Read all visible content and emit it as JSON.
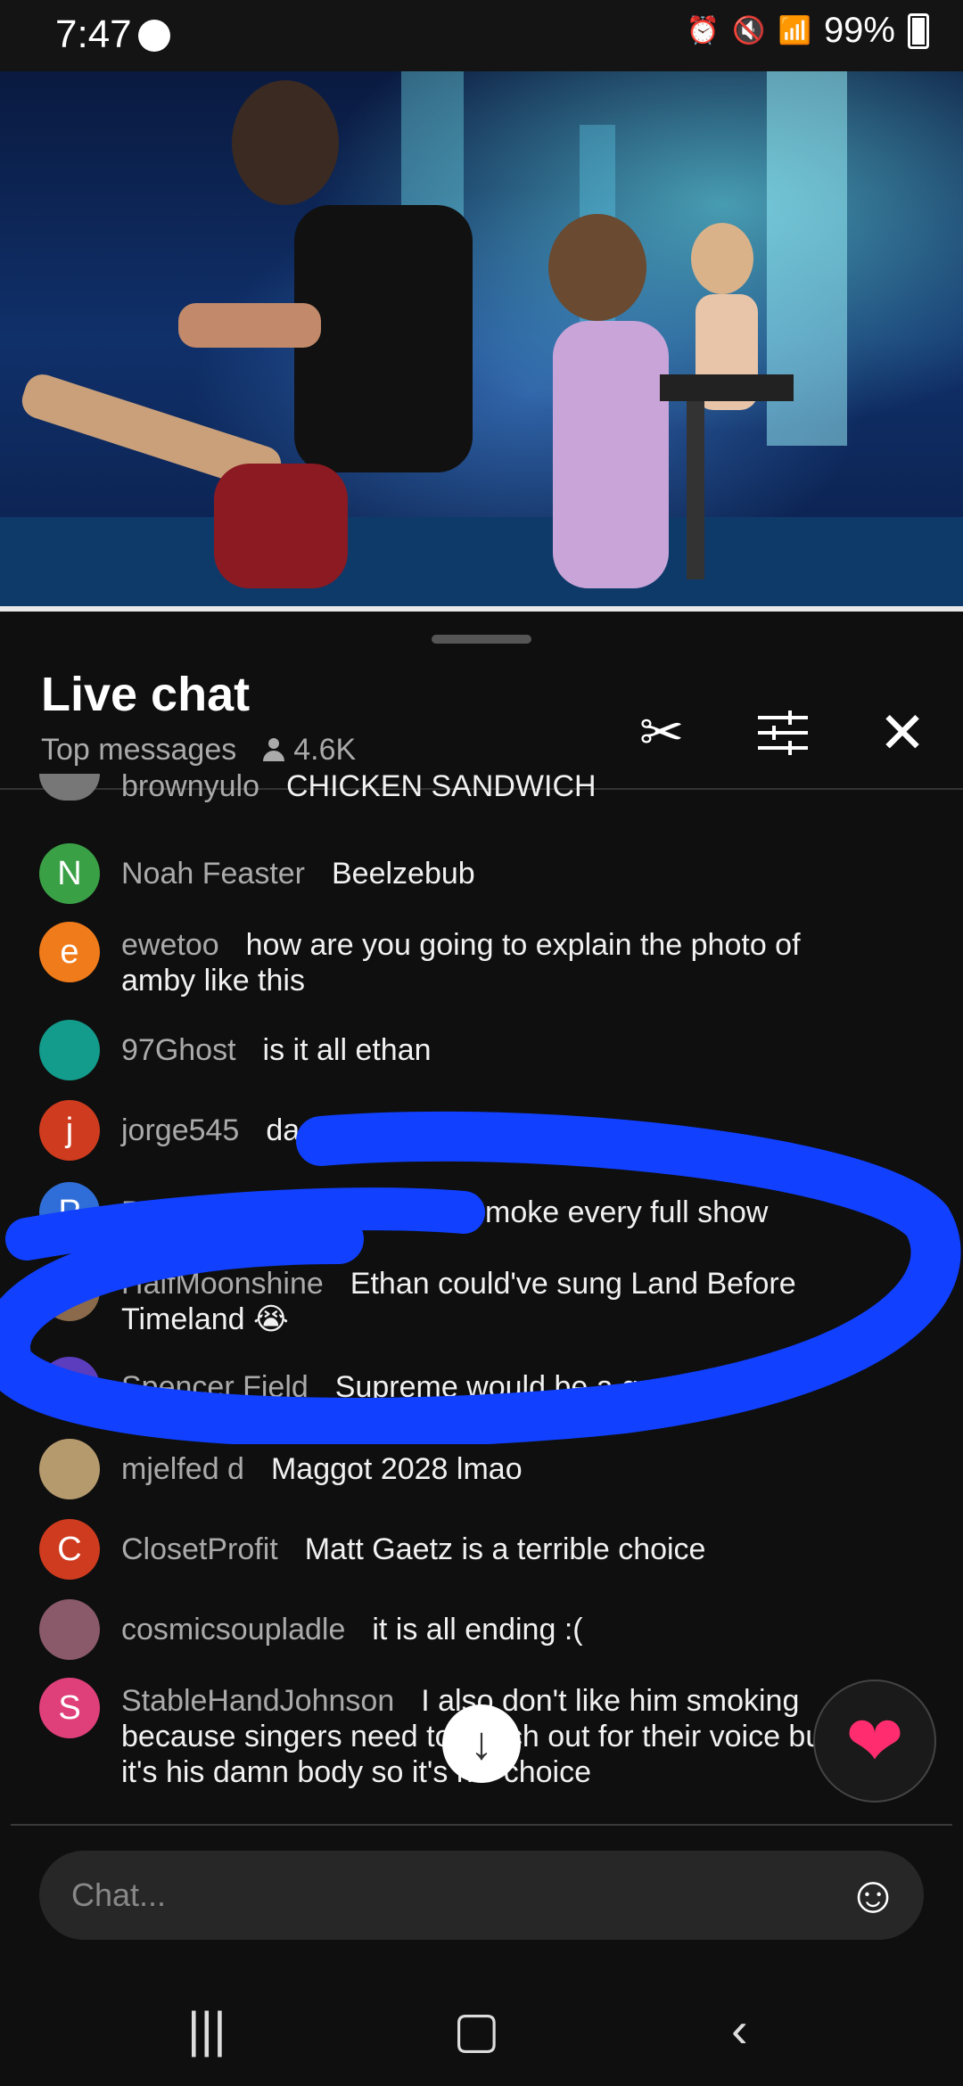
{
  "status_bar": {
    "time": "7:47",
    "battery": "99%"
  },
  "chat": {
    "title": "Live chat",
    "mode": "Top messages",
    "viewers": "4.6K",
    "input_placeholder": "Chat...",
    "messages": [
      {
        "author": "brownyulo",
        "text": "CHICKEN SANDWICH",
        "avatar_letter": "",
        "avatar_color": "#777"
      },
      {
        "author": "Noah Feaster",
        "text": "Beelzebub",
        "avatar_letter": "N",
        "avatar_color": "#3aa046"
      },
      {
        "author": "ewetoo",
        "text": "how are you going to explain the photo of amby like this",
        "avatar_letter": "e",
        "avatar_color": "#f07b1a"
      },
      {
        "author": "97Ghost",
        "text": "is it all ethan",
        "avatar_letter": "",
        "avatar_color": "#139b8b"
      },
      {
        "author": "jorge545",
        "text": "da",
        "avatar_letter": "j",
        "avatar_color": "#cf3b1f"
      },
      {
        "author": "Paul.",
        "text": "amby should chainsmoke every full show",
        "avatar_letter": "P",
        "avatar_color": "#2f6ed8"
      },
      {
        "author": "HalfMoonshine",
        "text": "Ethan could've sung Land Before Timeland 😭",
        "avatar_letter": "",
        "avatar_color": "#8a6a4a"
      },
      {
        "author": "Spencer Field",
        "text": "Supreme would be a great Bu",
        "avatar_letter": "S",
        "avatar_color": "#5b3dbd"
      },
      {
        "author": "mjelfed d",
        "text": "Maggot 2028 lmao",
        "avatar_letter": "",
        "avatar_color": "#b59a6d"
      },
      {
        "author": "ClosetProfit",
        "text": "Matt Gaetz is a terrible choice",
        "avatar_letter": "C",
        "avatar_color": "#cf3b1f"
      },
      {
        "author": "cosmicsoupladle",
        "text": "it is all ending :(",
        "avatar_letter": "",
        "avatar_color": "#8a5a6a"
      },
      {
        "author": "StableHandJohnson",
        "text": "I also don't like him smoking because singers need to watch out for their voice but it's his damn body so it's his choice",
        "avatar_letter": "S",
        "avatar_color": "#e0407a"
      }
    ]
  }
}
